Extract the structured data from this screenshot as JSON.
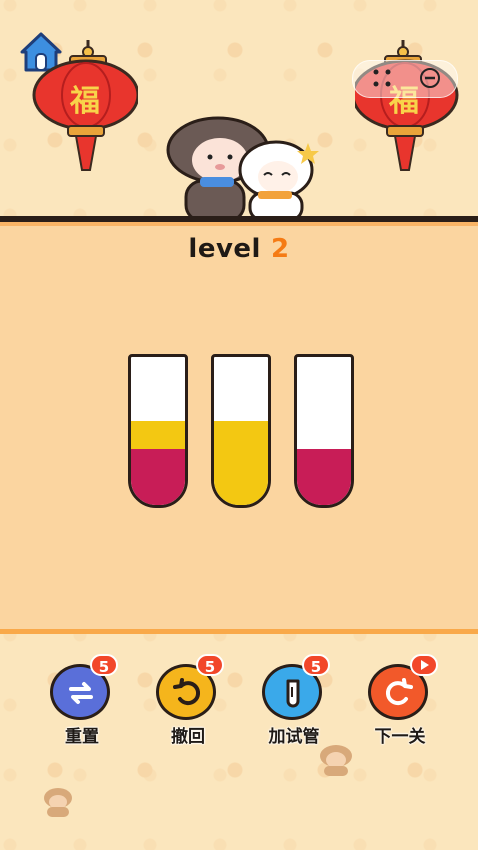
{
  "level": {
    "prefix": "level",
    "number": "2"
  },
  "colors": {
    "pink_liquid": "#c81d57",
    "yellow_liquid": "#f3c812",
    "reset": "#5a6fd9",
    "undo": "#f5b51c",
    "add_tube": "#3aa9ea",
    "next": "#f2592a"
  },
  "tubes": [
    {
      "layers": [
        "pink",
        "yellow"
      ]
    },
    {
      "layers": [
        "yellow",
        "yellow"
      ]
    },
    {
      "layers": [
        "pink"
      ]
    }
  ],
  "controls": {
    "reset": {
      "label": "重置",
      "count": "5",
      "icon": "swap-arrows-icon"
    },
    "undo": {
      "label": "撤回",
      "count": "5",
      "icon": "undo-icon"
    },
    "add_tube": {
      "label": "加试管",
      "count": "5",
      "icon": "test-tube-icon"
    },
    "next": {
      "label": "下一关",
      "icon": "redo-icon",
      "badge_icon": "video-play-icon"
    }
  },
  "decor": {
    "lantern_text": "福",
    "home_icon": "home-icon"
  }
}
